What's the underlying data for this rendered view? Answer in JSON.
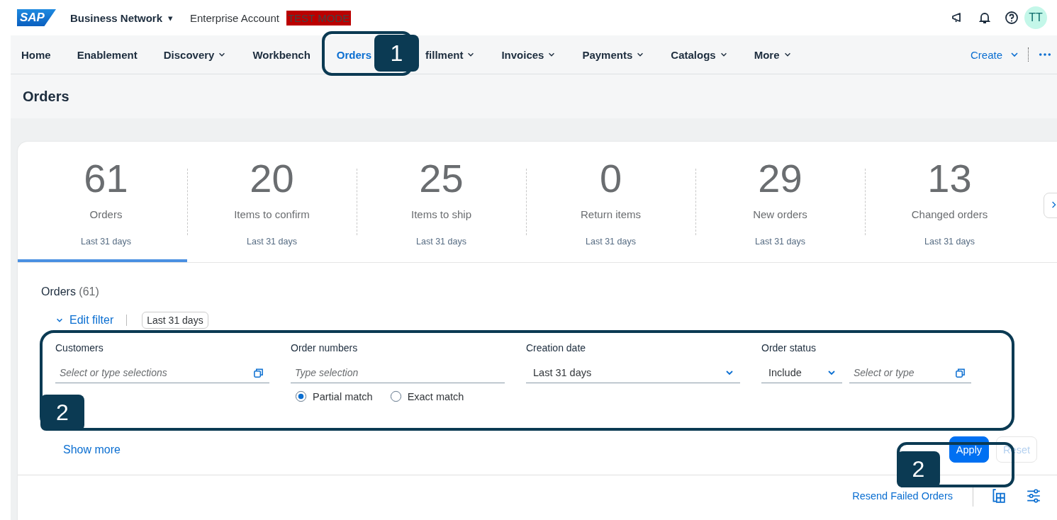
{
  "shell": {
    "logo": "SAP",
    "product": "Business Network",
    "product_caret": "▾",
    "account": "Enterprise Account",
    "mode_badge": "TEST MODE",
    "avatar": "TT"
  },
  "nav": {
    "items": [
      {
        "label": "Home",
        "selected": false,
        "dropdown": false
      },
      {
        "label": "Enablement",
        "selected": false,
        "dropdown": false
      },
      {
        "label": "Discovery",
        "selected": false,
        "dropdown": true
      },
      {
        "label": "Workbench",
        "selected": false,
        "dropdown": false
      },
      {
        "label": "Orders",
        "selected": true,
        "dropdown": false
      },
      {
        "label": "fillment",
        "selected": false,
        "dropdown": true
      },
      {
        "label": "Invoices",
        "selected": false,
        "dropdown": true
      },
      {
        "label": "Payments",
        "selected": false,
        "dropdown": true
      },
      {
        "label": "Catalogs",
        "selected": false,
        "dropdown": true
      },
      {
        "label": "More",
        "selected": false,
        "dropdown": true
      }
    ],
    "create": "Create"
  },
  "page_title": "Orders",
  "tiles": [
    {
      "value": "61",
      "label": "Orders",
      "period": "Last 31 days",
      "selected": true
    },
    {
      "value": "20",
      "label": "Items to confirm",
      "period": "Last 31 days",
      "selected": false
    },
    {
      "value": "25",
      "label": "Items to ship",
      "period": "Last 31 days",
      "selected": false
    },
    {
      "value": "0",
      "label": "Return items",
      "period": "Last 31 days",
      "selected": false
    },
    {
      "value": "29",
      "label": "New orders",
      "period": "Last 31 days",
      "selected": false
    },
    {
      "value": "13",
      "label": "Changed orders",
      "period": "Last 31 days",
      "selected": false
    }
  ],
  "section": {
    "title": "Orders",
    "count": "(61)",
    "edit_filter": "Edit filter",
    "filter_chip": "Last 31 days"
  },
  "filters": [
    {
      "kind": "multi",
      "label": "Customers",
      "placeholder": "Select or type selections"
    },
    {
      "kind": "match",
      "label": "Order numbers",
      "placeholder": "Type selection",
      "options": [
        {
          "label": "Partial match",
          "selected": true
        },
        {
          "label": "Exact match",
          "selected": false
        }
      ]
    },
    {
      "kind": "select",
      "label": "Creation date",
      "value": "Last 31 days"
    },
    {
      "kind": "status",
      "label": "Order status",
      "value": "Include",
      "placeholder": "Select or type"
    }
  ],
  "show_more": "Show more",
  "buttons": [
    {
      "label": "Apply",
      "disabled": false
    },
    {
      "label": "Reset",
      "disabled": true
    }
  ],
  "toolbar": {
    "resend": "Resend Failed Orders"
  },
  "callouts": [
    {
      "number": "1"
    },
    {
      "number": "2"
    },
    {
      "number": "2"
    }
  ]
}
